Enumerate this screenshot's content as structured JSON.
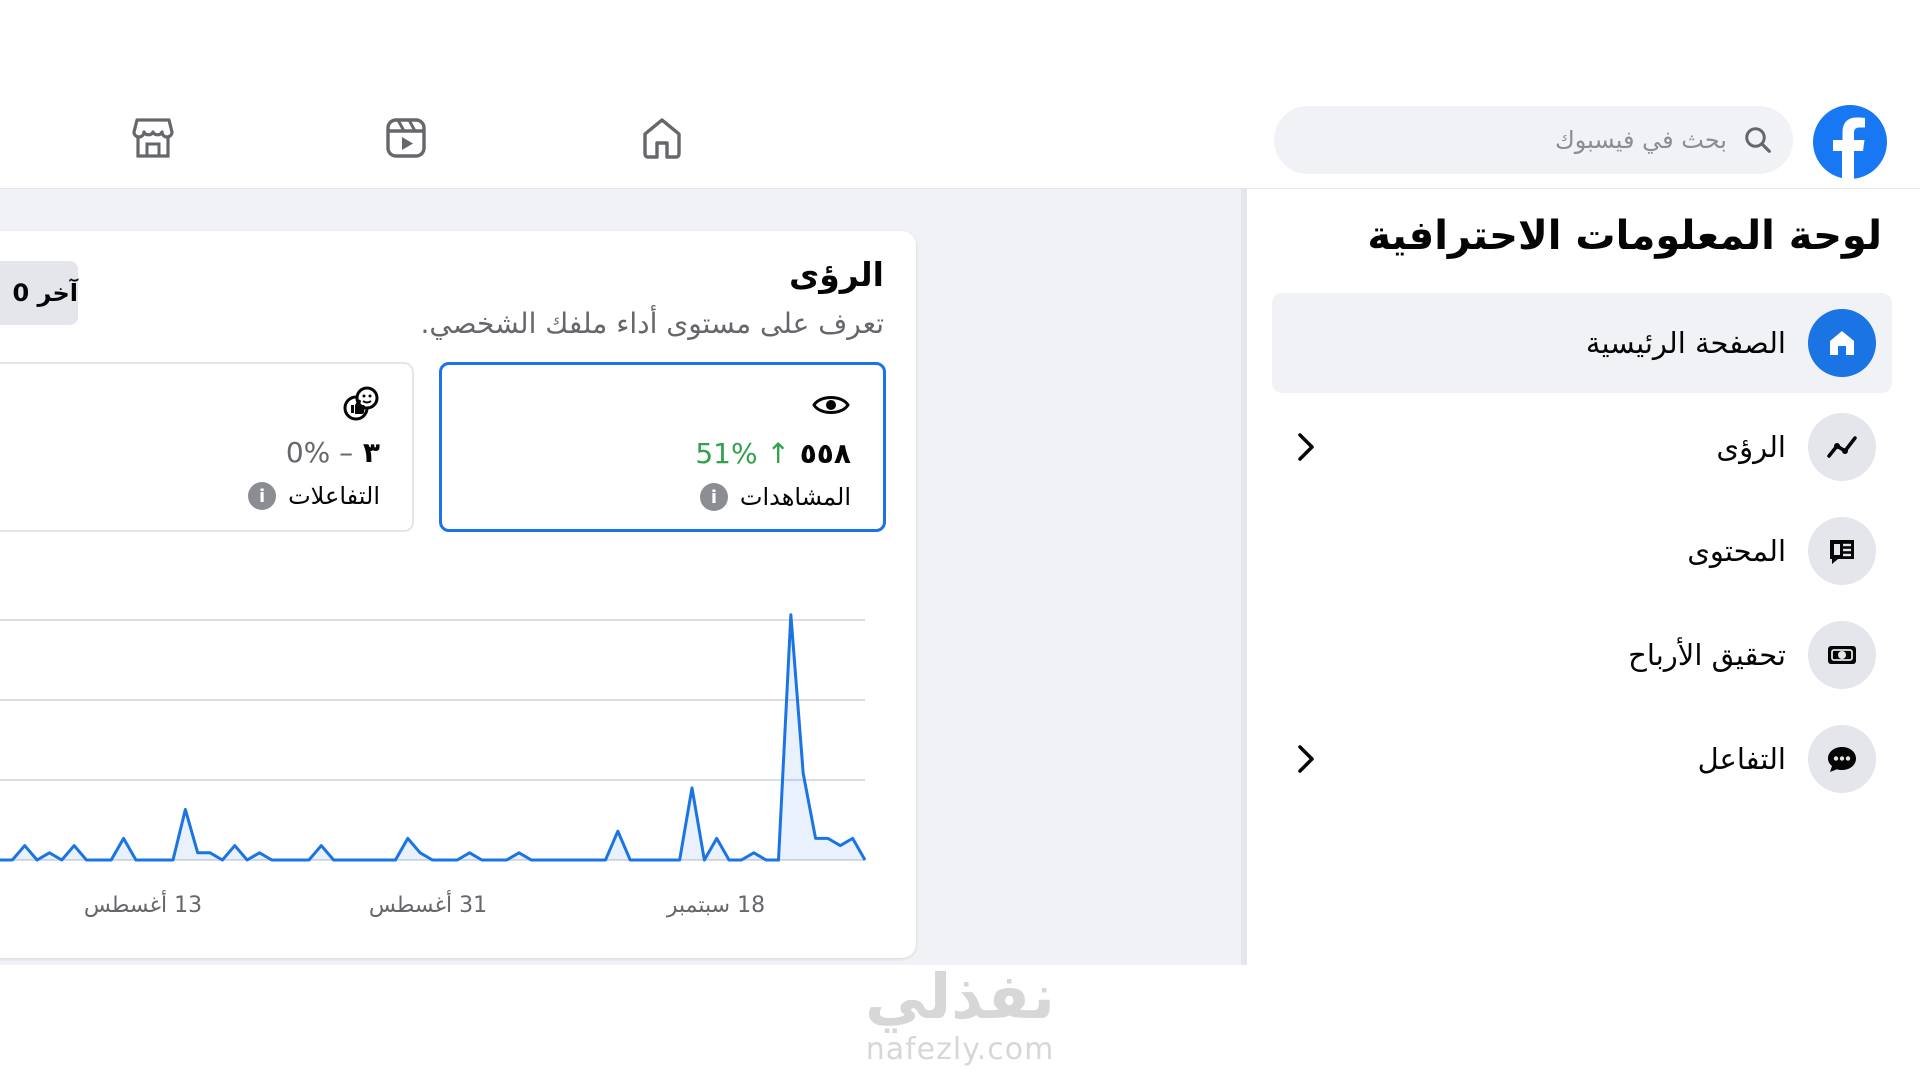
{
  "header": {
    "search_placeholder": "بحث في فيسبوك",
    "brand_color": "#1877f2"
  },
  "sidebar": {
    "title": "لوحة المعلومات الاحترافية",
    "items": [
      {
        "label": "الصفحة الرئيسية",
        "icon": "home-icon",
        "active": true
      },
      {
        "label": "الرؤى",
        "icon": "insights-icon",
        "expandable": true
      },
      {
        "label": "المحتوى",
        "icon": "content-icon"
      },
      {
        "label": "تحقيق الأرباح",
        "icon": "money-icon"
      },
      {
        "label": "التفاعل",
        "icon": "chat-icon",
        "expandable": true
      }
    ]
  },
  "insights": {
    "title": "الرؤى",
    "subtitle": "تعرف على مستوى أداء ملفك الشخصي.",
    "range_label": "آخر 0",
    "metrics": [
      {
        "label": "المشاهدات",
        "value": "٥٥٨",
        "change": "↑ 51%",
        "change_color": "#31a24c",
        "icon": "eye-icon",
        "selected": true
      },
      {
        "label": "التفاعلات",
        "value": "٣",
        "change": "– 0%",
        "change_color": "#65676b",
        "icon": "reactions-icon",
        "selected": false
      }
    ]
  },
  "chart_data": {
    "type": "area",
    "color": "#1b74e4",
    "x_tick_labels": [
      "13 أغسطس",
      "31 أغسطس",
      "18 سبتمبر"
    ],
    "values": [
      0,
      0,
      2,
      0,
      1,
      0,
      2,
      0,
      0,
      0,
      3,
      0,
      0,
      0,
      0,
      7,
      1,
      1,
      0,
      2,
      0,
      1,
      0,
      0,
      0,
      0,
      2,
      0,
      0,
      0,
      0,
      0,
      0,
      3,
      1,
      0,
      0,
      0,
      1,
      0,
      0,
      0,
      1,
      0,
      0,
      0,
      0,
      0,
      0,
      0,
      4,
      0,
      0,
      0,
      0,
      0,
      10,
      0,
      3,
      0,
      0,
      1,
      0,
      0,
      34,
      12,
      3,
      3,
      2,
      3,
      0
    ],
    "gridlines": 4
  },
  "watermark": {
    "arabic": "نفذلي",
    "latin": "nafezly.com"
  }
}
